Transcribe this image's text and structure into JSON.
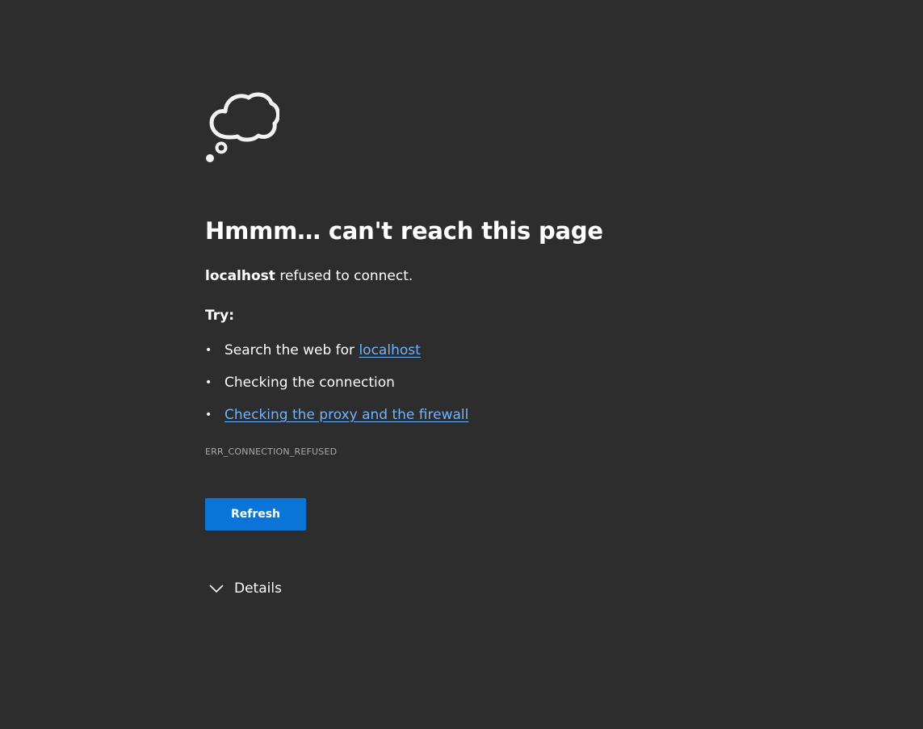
{
  "error": {
    "title": "Hmmm… can't reach this page",
    "host": "localhost",
    "message_suffix": " refused to connect.",
    "try_heading": "Try:",
    "suggestions": [
      {
        "prefix": "Search the web for ",
        "link": "localhost"
      },
      {
        "text": "Checking the connection"
      },
      {
        "link": "Checking the proxy and the firewall"
      }
    ],
    "code": "ERR_CONNECTION_REFUSED",
    "refresh_label": "Refresh",
    "details_label": "Details"
  },
  "icons": {
    "illustration": "thought-cloud-icon",
    "details_toggle": "chevron-down-icon"
  },
  "colors": {
    "background": "#2d2d2d",
    "link": "#6fb3ff",
    "button": "#0a74d8",
    "muted_text": "#a8a8a8"
  }
}
